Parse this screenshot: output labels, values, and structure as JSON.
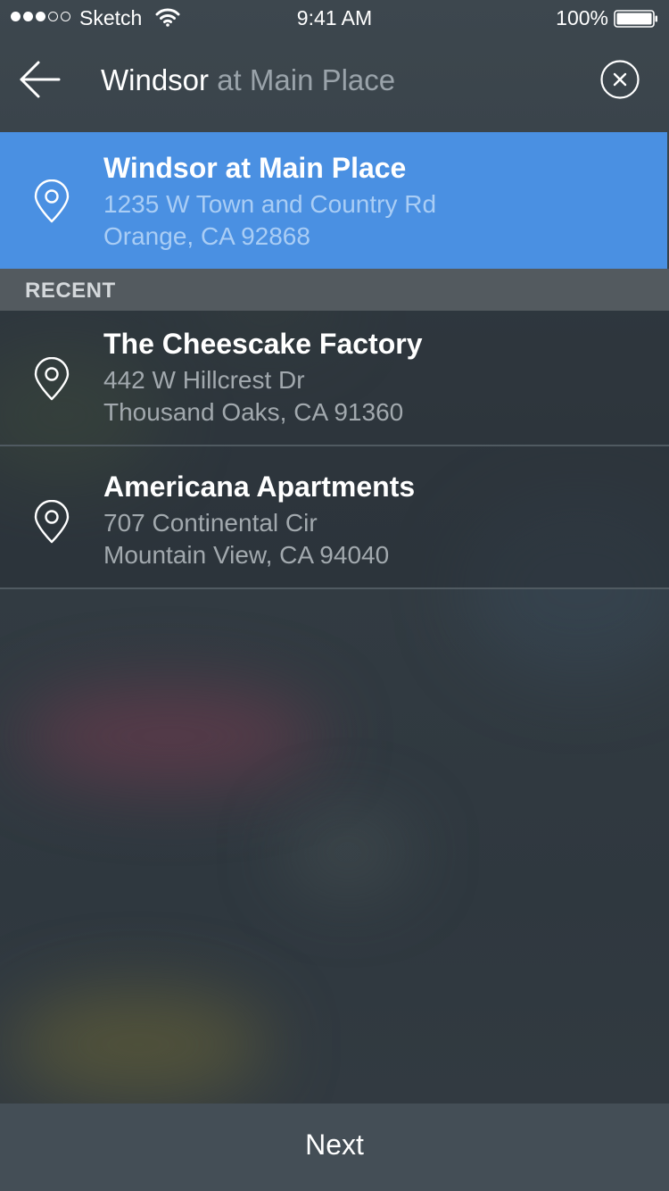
{
  "status_bar": {
    "carrier": "Sketch",
    "signal_bars_filled": 3,
    "signal_bars_total": 5,
    "time": "9:41 AM",
    "battery": "100%"
  },
  "search": {
    "typed_text": "Windsor",
    "suggestion_text": " at Main Place",
    "back_icon": "arrow-left-icon",
    "clear_icon": "close-circle-icon"
  },
  "selected_result": {
    "title": "Windsor at Main Place",
    "address_line1": "1235 W Town and Country Rd",
    "address_line2": "Orange, CA 92868",
    "icon": "map-pin-icon"
  },
  "recent": {
    "header": "RECENT",
    "items": [
      {
        "title": "The Cheescake Factory",
        "address_line1": "442 W Hillcrest Dr",
        "address_line2": "Thousand Oaks, CA 91360",
        "icon": "map-pin-icon"
      },
      {
        "title": "Americana Apartments",
        "address_line1": "707 Continental Cir",
        "address_line2": "Mountain View, CA 94040",
        "icon": "map-pin-icon"
      }
    ]
  },
  "footer": {
    "next_label": "Next"
  },
  "colors": {
    "selected_row": "#4a90e2",
    "footer_bar": "#444e56",
    "background": "#323b42"
  }
}
